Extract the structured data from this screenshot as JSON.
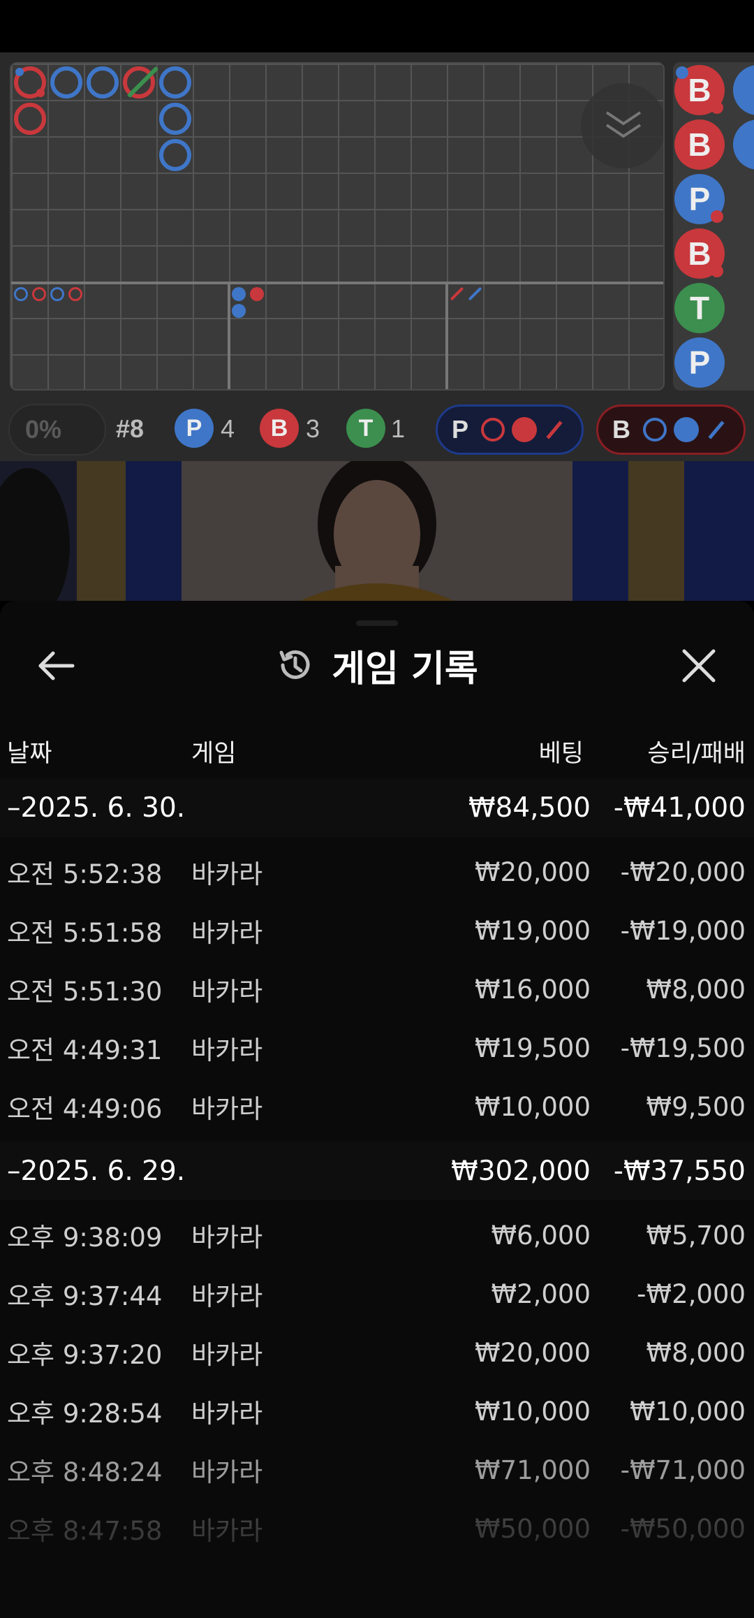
{
  "roadmap": {
    "stats": {
      "percent": "0%",
      "round": "#8",
      "player": {
        "letter": "P",
        "count": "4"
      },
      "banker": {
        "letter": "B",
        "count": "3"
      },
      "tie": {
        "letter": "T",
        "count": "1"
      }
    },
    "predict": {
      "player_letter": "P",
      "banker_letter": "B"
    },
    "side_balls": [
      "B",
      "B",
      "P",
      "B",
      "T",
      "P"
    ],
    "colors": {
      "player": "#3f76c8",
      "banker": "#c9383c",
      "tie": "#3c8f4e"
    }
  },
  "history": {
    "title": "게임 기록",
    "icons": {
      "back": "arrow-left-icon",
      "history": "history-icon",
      "close": "close-icon"
    },
    "columns": {
      "date": "날짜",
      "game": "게임",
      "bet": "베팅",
      "result": "승리/패배"
    },
    "groups": [
      {
        "date": "–2025. 6. 30.",
        "bet": "₩84,500",
        "result": "-₩41,000",
        "rows": [
          {
            "time": "오전 5:52:38",
            "game": "바카라",
            "bet": "₩20,000",
            "result": "-₩20,000"
          },
          {
            "time": "오전 5:51:58",
            "game": "바카라",
            "bet": "₩19,000",
            "result": "-₩19,000"
          },
          {
            "time": "오전 5:51:30",
            "game": "바카라",
            "bet": "₩16,000",
            "result": "₩8,000"
          },
          {
            "time": "오전 4:49:31",
            "game": "바카라",
            "bet": "₩19,500",
            "result": "-₩19,500"
          },
          {
            "time": "오전 4:49:06",
            "game": "바카라",
            "bet": "₩10,000",
            "result": "₩9,500"
          }
        ]
      },
      {
        "date": "–2025. 6. 29.",
        "bet": "₩302,000",
        "result": "-₩37,550",
        "rows": [
          {
            "time": "오후 9:38:09",
            "game": "바카라",
            "bet": "₩6,000",
            "result": "₩5,700"
          },
          {
            "time": "오후 9:37:44",
            "game": "바카라",
            "bet": "₩2,000",
            "result": "-₩2,000"
          },
          {
            "time": "오후 9:37:20",
            "game": "바카라",
            "bet": "₩20,000",
            "result": "₩8,000"
          },
          {
            "time": "오후 9:28:54",
            "game": "바카라",
            "bet": "₩10,000",
            "result": "₩10,000"
          },
          {
            "time": "오후 8:48:24",
            "game": "바카라",
            "bet": "₩71,000",
            "result": "-₩71,000"
          },
          {
            "time": "오후 8:47:58",
            "game": "바카라",
            "bet": "₩50,000",
            "result": "-₩50,000"
          }
        ]
      }
    ]
  }
}
